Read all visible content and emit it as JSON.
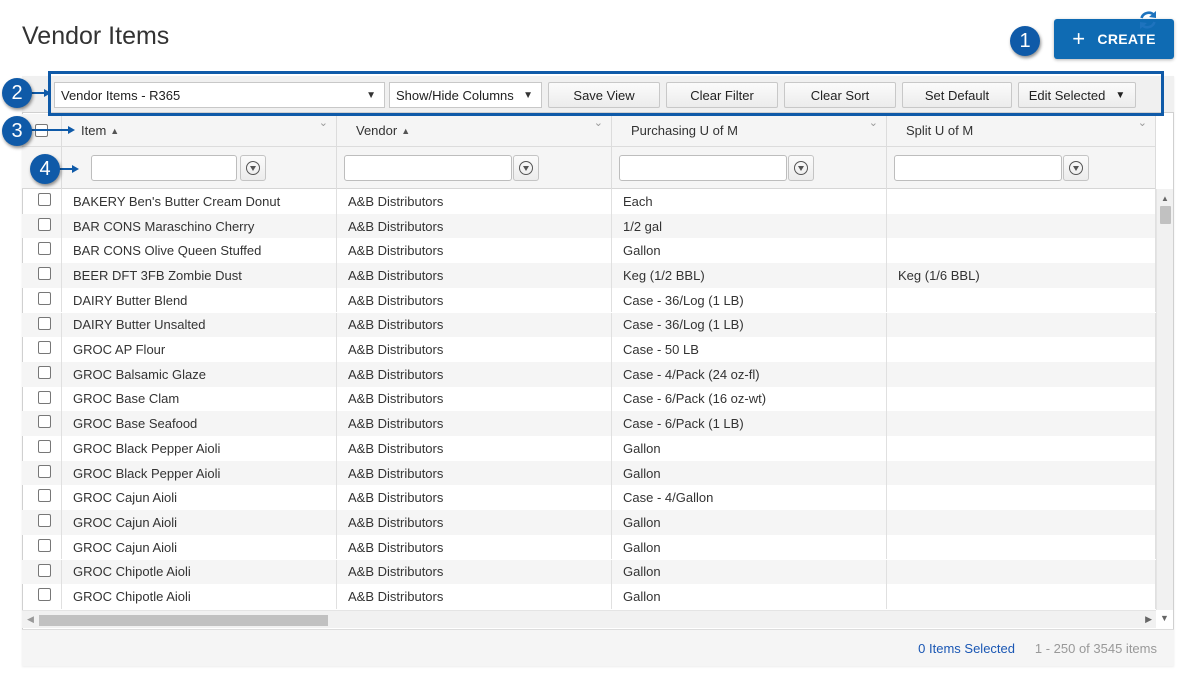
{
  "page": {
    "title": "Vendor Items"
  },
  "create_button": {
    "icon": "plus-icon",
    "label": "CREATE"
  },
  "callouts": [
    "1",
    "2",
    "3",
    "4"
  ],
  "toolbar": {
    "view_select": "Vendor Items - R365",
    "show_hide": "Show/Hide Columns",
    "save_view": "Save View",
    "clear_filter": "Clear Filter",
    "clear_sort": "Clear Sort",
    "set_default": "Set Default",
    "edit_selected": "Edit Selected",
    "refresh_icon": "refresh-icon"
  },
  "columns": [
    {
      "label": "Item",
      "sort": "▲"
    },
    {
      "label": "Vendor",
      "sort": "▲"
    },
    {
      "label": "Purchasing U of M",
      "sort": ""
    },
    {
      "label": "Split U of M",
      "sort": ""
    }
  ],
  "rows": [
    [
      "BAKERY Ben's Butter Cream Donut",
      "A&B Distributors",
      "Each",
      ""
    ],
    [
      "BAR CONS Maraschino Cherry",
      "A&B Distributors",
      "1/2 gal",
      ""
    ],
    [
      "BAR CONS Olive Queen Stuffed",
      "A&B Distributors",
      "Gallon",
      ""
    ],
    [
      "BEER DFT 3FB Zombie Dust",
      "A&B Distributors",
      "Keg (1/2 BBL)",
      "Keg (1/6 BBL)"
    ],
    [
      "DAIRY Butter Blend",
      "A&B Distributors",
      "Case - 36/Log (1 LB)",
      ""
    ],
    [
      "DAIRY Butter Unsalted",
      "A&B Distributors",
      "Case - 36/Log (1 LB)",
      ""
    ],
    [
      "GROC AP Flour",
      "A&B Distributors",
      "Case - 50 LB",
      ""
    ],
    [
      "GROC Balsamic Glaze",
      "A&B Distributors",
      "Case - 4/Pack (24 oz-fl)",
      ""
    ],
    [
      "GROC Base Clam",
      "A&B Distributors",
      "Case - 6/Pack (16 oz-wt)",
      ""
    ],
    [
      "GROC Base Seafood",
      "A&B Distributors",
      "Case - 6/Pack (1 LB)",
      ""
    ],
    [
      "GROC Black Pepper Aioli",
      "A&B Distributors",
      "Gallon",
      ""
    ],
    [
      "GROC Black Pepper Aioli",
      "A&B Distributors",
      "Gallon",
      ""
    ],
    [
      "GROC Cajun Aioli",
      "A&B Distributors",
      "Case - 4/Gallon",
      ""
    ],
    [
      "GROC Cajun Aioli",
      "A&B Distributors",
      "Gallon",
      ""
    ],
    [
      "GROC Cajun Aioli",
      "A&B Distributors",
      "Gallon",
      ""
    ],
    [
      "GROC Chipotle Aioli",
      "A&B Distributors",
      "Gallon",
      ""
    ],
    [
      "GROC Chipotle Aioli",
      "A&B Distributors",
      "Gallon",
      ""
    ]
  ],
  "footer": {
    "selected": "0 Items Selected",
    "range": "1 - 250 of 3545 items"
  }
}
